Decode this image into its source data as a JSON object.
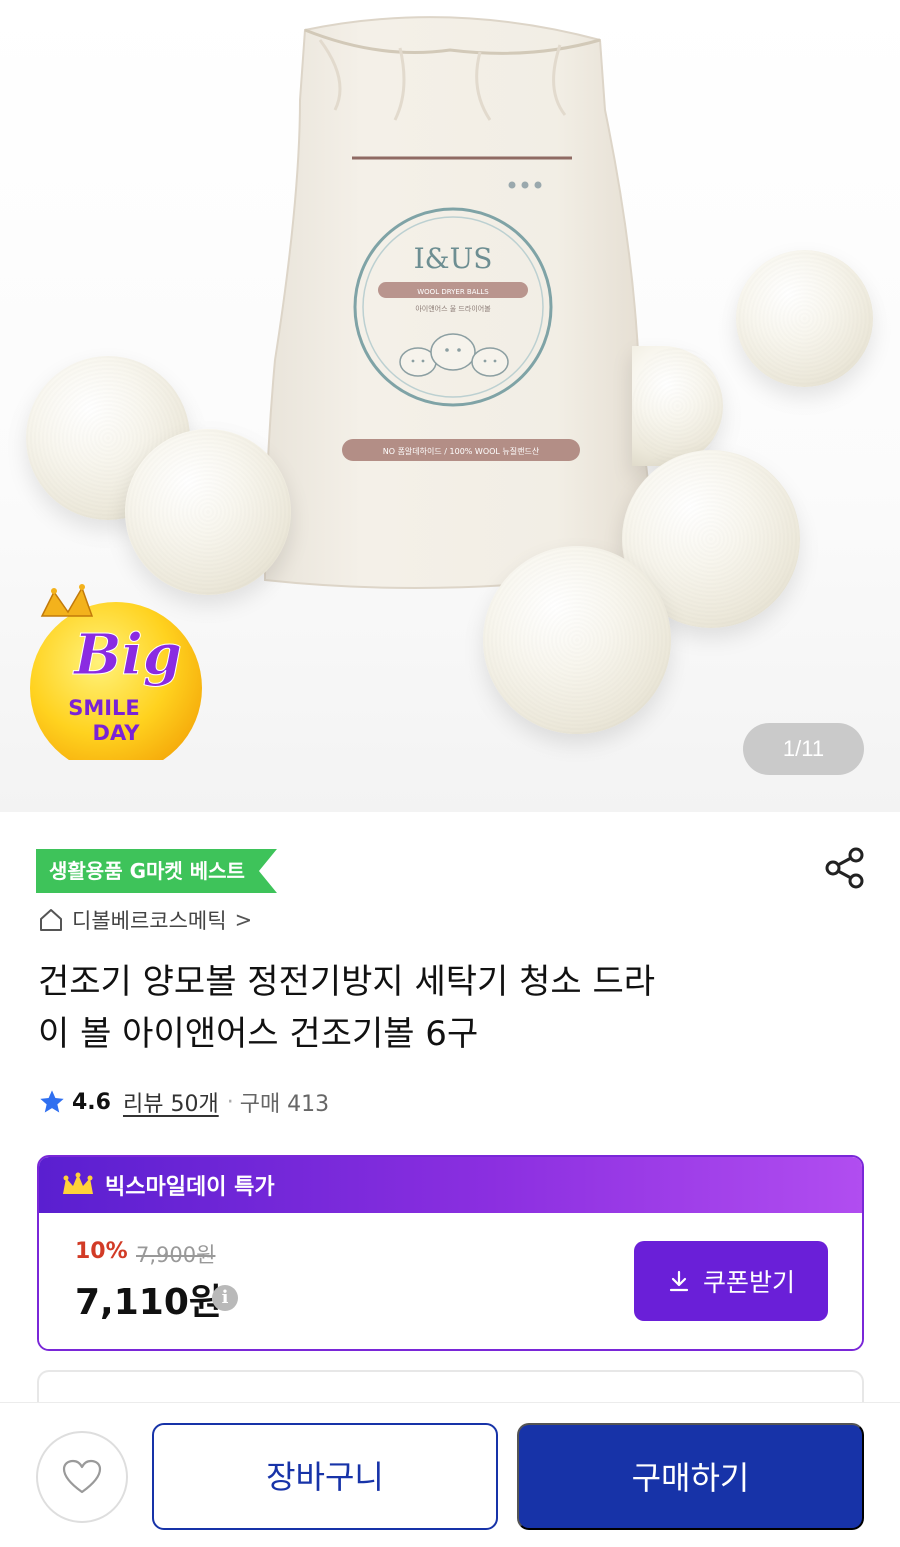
{
  "gallery": {
    "counter": "1/11",
    "bag_brand": "I&US",
    "bag_subtitle": "WOOL DRYER BALLS",
    "bag_korean": "아이앤어스 울 드라이어볼",
    "bag_tagline": "NO 폼알데하이드 / 100% WOOL 뉴질랜드산",
    "badge": {
      "line1": "Big",
      "line2": "SMILE",
      "line3": "DAY"
    }
  },
  "product": {
    "best_tag": "생활용품 G마켓 베스트",
    "store_name": "디볼베르코스메틱",
    "store_chevron": ">",
    "title_line1": "건조기 양모볼 정전기방지 세탁기 청소 드라",
    "title_line2": "이 볼 아이앤어스 건조기볼 6구",
    "rating": "4.6",
    "reviews": "리뷰 50개",
    "separator": "·",
    "purchases": "구매 413"
  },
  "promo": {
    "title": "빅스마일데이 특가",
    "discount": "10%",
    "original_price": "7,900원",
    "price": "7,110원",
    "info_glyph": "i",
    "coupon_label": "쿠폰받기"
  },
  "bottom_bar": {
    "cart_label": "장바구니",
    "buy_label": "구매하기"
  },
  "colors": {
    "best_tag": "#3ec35a",
    "promo_accent": "#6a1fd8",
    "primary_blue": "#1733a8",
    "discount_red": "#d23b26"
  },
  "icons": [
    "share-icon",
    "home-icon",
    "star-icon",
    "crown-icon",
    "download-icon",
    "heart-icon",
    "info-icon"
  ]
}
